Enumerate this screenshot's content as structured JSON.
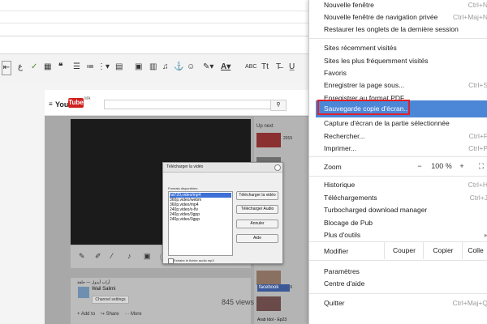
{
  "editor": {
    "toolbar_icons": [
      "indent-icon",
      "arabic-letter-icon",
      "spell-check-icon",
      "table-icon",
      "quote-icon",
      "list-icon",
      "bullet-list-icon",
      "image-icon",
      "film-icon",
      "music-icon",
      "anchor-icon",
      "highlight-icon",
      "font-color-icon",
      "abc-icon",
      "font-size-icon",
      "underline-icon"
    ],
    "toolbar_glyphs": {
      "abc": "ABC",
      "case": "Tt"
    }
  },
  "youtube": {
    "logo_you": "You",
    "logo_tube": "Tube",
    "logo_region": "MA",
    "up_next": "Up next",
    "channel_name": "Wail Salimi",
    "channel_button": "Channel settings",
    "views": "845 views",
    "add_to": "Add to",
    "share": "Share",
    "more": "More",
    "facebook_label": "facebook",
    "sidebar_item": "Arab Idol - Ep23",
    "sidebar_years": [
      "2015",
      "2016"
    ]
  },
  "download_dialog": {
    "title": "Télécharger la vidéo",
    "formats_label": "Formats disponibles:",
    "formats": [
      "hd720,video/mp4",
      "360p,video/webm",
      "360p,video/mp4",
      "240p,video/x-flv",
      "240p,video/3gpp",
      "240p,video/3gpp"
    ],
    "selected_index": 0,
    "buttons": {
      "download_video": "Télécharger la vidéo",
      "download_audio": "Télécharger Audio",
      "cancel": "Annuler",
      "help": "Aide"
    },
    "checkbox_label": "Extraire le fichier audio mp3"
  },
  "menu": {
    "new_window": "Nouvelle fenêtre",
    "new_window_shortcut": "Ctrl+N",
    "new_incognito": "Nouvelle fenêtre de navigation privée",
    "new_incognito_shortcut": "Ctrl+Maj+N",
    "restore_tabs": "Restaurer les onglets de la dernière session",
    "recent_sites": "Sites récemment visités",
    "most_visited": "Sites les plus fréquemment visités",
    "favorites": "Favoris",
    "save_page": "Enregistrer la page sous...",
    "save_page_shortcut": "Ctrl+S",
    "save_pdf": "Enregistrer au format PDF...",
    "save_screenshot": "Sauvegarde copie d'écran...",
    "capture_selection": "Capture d'écran de la partie sélectionnée",
    "find": "Rechercher...",
    "find_shortcut": "Ctrl+F",
    "print": "Imprimer...",
    "print_shortcut": "Ctrl+P",
    "zoom_label": "Zoom",
    "zoom_minus": "−",
    "zoom_value": "100 %",
    "zoom_plus": "+",
    "history": "Historique",
    "history_shortcut": "Ctrl+H",
    "downloads": "Téléchargements",
    "downloads_shortcut": "Ctrl+J",
    "turbocharged": "Turbocharged download manager",
    "adblock": "Blocage de Pub",
    "more_tools": "Plus d'outils",
    "edit_label": "Modifier",
    "cut": "Couper",
    "copy": "Copier",
    "paste": "Colle",
    "settings": "Paramètres",
    "help_center": "Centre d'aide",
    "quit": "Quitter",
    "quit_shortcut": "Ctrl+Maj+Q"
  },
  "colors": {
    "highlight": "#4c86d7",
    "callout_border": "#e1202b",
    "youtube_red": "#d02020",
    "facebook_blue": "#3b5998"
  }
}
